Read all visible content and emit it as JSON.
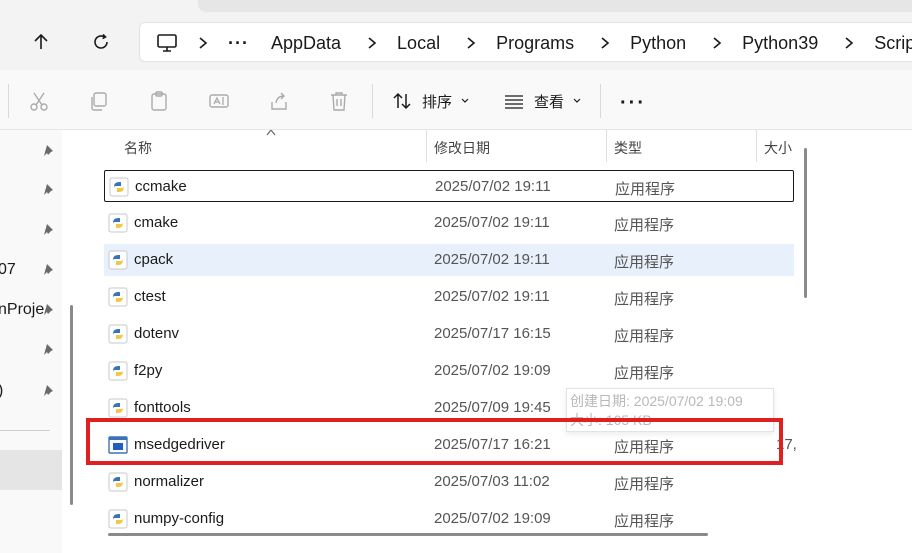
{
  "nav": {
    "back": "back-arrow",
    "refresh": "refresh"
  },
  "breadcrumb": {
    "ellipsis": "···",
    "items": [
      "AppData",
      "Local",
      "Programs",
      "Python",
      "Python39",
      "Scripts"
    ]
  },
  "toolbar": {
    "sort_label": "排序",
    "view_label": "查看",
    "more_label": "···"
  },
  "nav_pane": {
    "items": [
      "",
      "",
      "",
      "07",
      "nProje",
      "",
      ")"
    ]
  },
  "columns": {
    "name": "名称",
    "modified": "修改日期",
    "type": "类型",
    "size": "大小"
  },
  "files": [
    {
      "name": "ccmake",
      "modified": "2025/07/02 19:11",
      "type": "应用程序",
      "size": "",
      "icon": "python-file-icon"
    },
    {
      "name": "cmake",
      "modified": "2025/07/02 19:11",
      "type": "应用程序",
      "size": "",
      "icon": "python-file-icon"
    },
    {
      "name": "cpack",
      "modified": "2025/07/02 19:11",
      "type": "应用程序",
      "size": "",
      "icon": "python-file-icon"
    },
    {
      "name": "ctest",
      "modified": "2025/07/02 19:11",
      "type": "应用程序",
      "size": "",
      "icon": "python-file-icon"
    },
    {
      "name": "dotenv",
      "modified": "2025/07/17 16:15",
      "type": "应用程序",
      "size": "",
      "icon": "python-file-icon"
    },
    {
      "name": "f2py",
      "modified": "2025/07/02 19:09",
      "type": "应用程序",
      "size": "",
      "icon": "python-file-icon"
    },
    {
      "name": "fonttools",
      "modified": "2025/07/09 19:45",
      "type": "应用程序",
      "size": "",
      "icon": "python-file-icon"
    },
    {
      "name": "msedgedriver",
      "modified": "2025/07/17 16:21",
      "type": "应用程序",
      "size": "17,",
      "icon": "exe-file-icon"
    },
    {
      "name": "normalizer",
      "modified": "2025/07/03 11:02",
      "type": "应用程序",
      "size": "",
      "icon": "python-file-icon"
    },
    {
      "name": "numpy-config",
      "modified": "2025/07/02 19:09",
      "type": "应用程序",
      "size": "",
      "icon": "python-file-icon"
    }
  ],
  "tooltip": {
    "line1": "创建日期: 2025/07/02 19:09",
    "line2": "大小: 105 KB"
  },
  "colors": {
    "highlight": "#e02020",
    "hover_row": "#e8f1fb"
  }
}
